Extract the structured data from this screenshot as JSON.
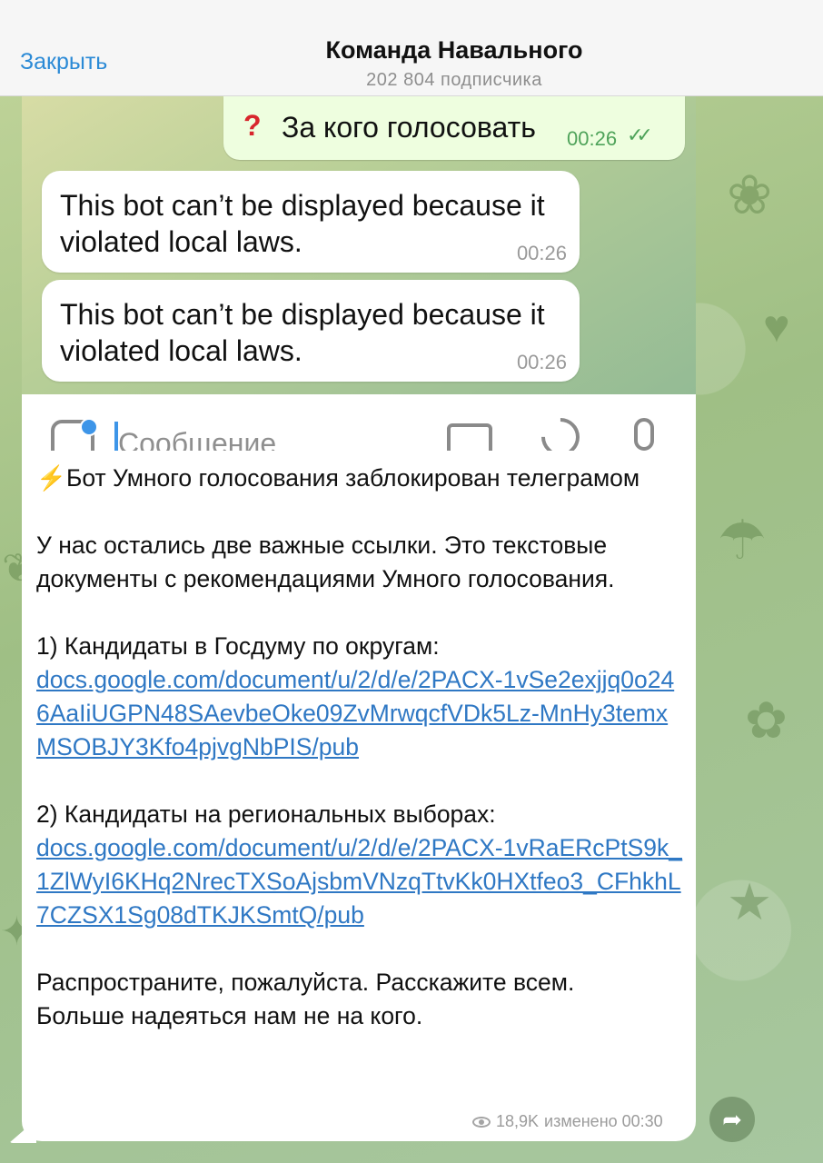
{
  "header": {
    "close_label": "Закрыть",
    "title": "Команда Навального",
    "subtitle": "202 804 подписчика"
  },
  "embedded_chat": {
    "outgoing": {
      "icon": "red-question-mark",
      "text": "За кого голосовать",
      "time": "00:26"
    },
    "incoming": [
      {
        "text": "This bot can’t be displayed because it violated local laws.",
        "time": "00:26"
      },
      {
        "text": "This bot can’t be displayed because it violated local laws.",
        "time": "00:26"
      }
    ],
    "input_placeholder": "Сообщение"
  },
  "post": {
    "heading_icon": "lightning-icon",
    "heading": "Бот Умного голосования заблокирован телеграмом",
    "intro": "У нас остались две важные ссылки. Это текстовые документы с рекомендациями Умного голосования.",
    "item1_label": "1) Кандидаты в Госдуму по округам:",
    "item1_link": "docs.google.com/document/u/2/d/e/2PACX-1vSe2exjjq0o246AaIiUGPN48SAevbeOke09ZvMrwqcfVDk5Lz-MnHy3temxMSOBJY3Kfo4pjvgNbPIS/pub",
    "item2_label": "2) Кандидаты на региональных выборах:",
    "item2_link": "docs.google.com/document/u/2/d/e/2PACX-1vRaERcPtS9k_1ZlWyI6KHq2NrecTXSoAjsbmVNzqTtvKk0HXtfeo3_CFhkhL7CZSX1Sg08dTKJKSmtQ/pub",
    "outro1": "Распространите, пожалуйста. Расскажите всем.",
    "outro2": "Больше надеяться нам не на кого.",
    "views": "18,9K",
    "edited": "изменено 00:30"
  },
  "colors": {
    "accent": "#2b8ad6",
    "link": "#2f78c4",
    "outgoing_bubble": "#eefedf",
    "wallpaper": "#a9c48d"
  }
}
